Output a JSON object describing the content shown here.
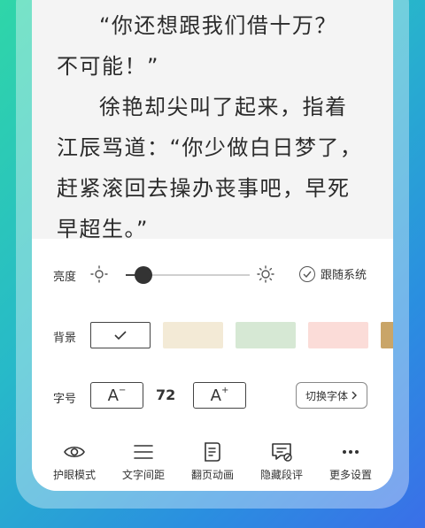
{
  "reading": {
    "lines": [
      {
        "text": "“你还想跟我们借十万？",
        "indent": true
      },
      {
        "text": "不可能！”",
        "indent": false
      },
      {
        "text": "徐艳却尖叫了起来，指着",
        "indent": true
      },
      {
        "text": "江辰骂道：“你少做白日梦了，",
        "indent": false
      },
      {
        "text": "赶紧滚回去操办丧事吧，早死",
        "indent": false
      },
      {
        "text": "早超生。”",
        "indent": false
      }
    ]
  },
  "settings": {
    "brightness": {
      "label": "亮度",
      "level_percent": 10,
      "follow_system_label": "跟随系统"
    },
    "background": {
      "label": "背景",
      "swatches": [
        "#ffffff",
        "#f3ead6",
        "#d6e8d4",
        "#fbdcd8",
        "#c9a568"
      ]
    },
    "font_size": {
      "label": "字号",
      "decrease_label": "A",
      "increase_label": "A",
      "value": "72",
      "switch_font_label": "切换字体"
    }
  },
  "toolbar": {
    "items": [
      {
        "label": "护眼模式",
        "icon": "eye-icon"
      },
      {
        "label": "文字间距",
        "icon": "text-spacing-icon"
      },
      {
        "label": "翻页动画",
        "icon": "page-turn-icon"
      },
      {
        "label": "隐藏段评",
        "icon": "hide-comment-icon"
      },
      {
        "label": "更多设置",
        "icon": "more-icon"
      }
    ]
  },
  "colors": {
    "accent": "#333333",
    "selected_border": "#444444"
  }
}
